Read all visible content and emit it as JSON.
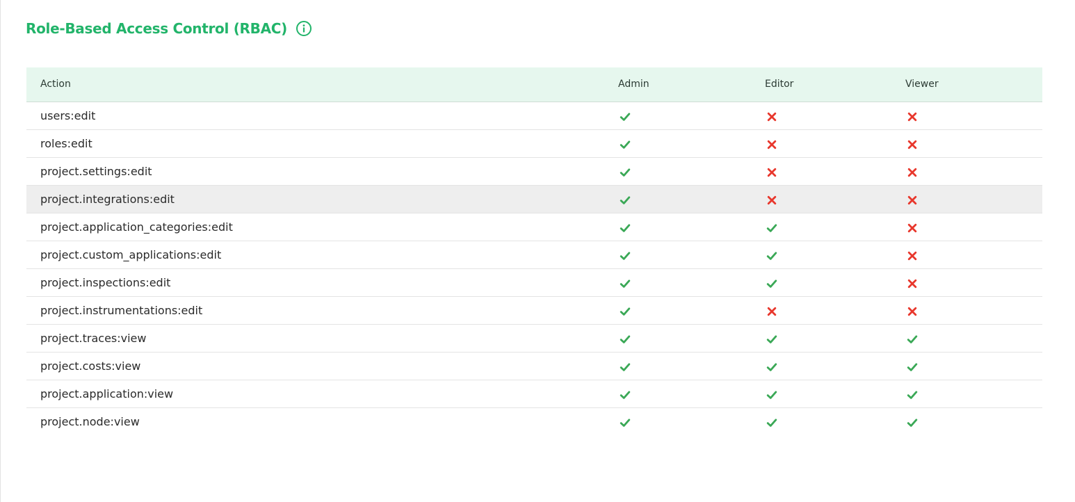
{
  "title": "Role-Based Access Control (RBAC)",
  "icons": {
    "info": "info-circle-icon",
    "allowed": "check-icon",
    "denied": "cross-icon"
  },
  "colors": {
    "accent": "#22b46a",
    "header_bg": "#e6f7ee",
    "check": "#3aa856",
    "cross": "#e8372c",
    "row_hover": "#eeeeee"
  },
  "table": {
    "headers": [
      "Action",
      "Admin",
      "Editor",
      "Viewer"
    ],
    "hovered_row": 3,
    "rows": [
      {
        "action": "users:edit",
        "admin": true,
        "editor": false,
        "viewer": false
      },
      {
        "action": "roles:edit",
        "admin": true,
        "editor": false,
        "viewer": false
      },
      {
        "action": "project.settings:edit",
        "admin": true,
        "editor": false,
        "viewer": false
      },
      {
        "action": "project.integrations:edit",
        "admin": true,
        "editor": false,
        "viewer": false
      },
      {
        "action": "project.application_categories:edit",
        "admin": true,
        "editor": true,
        "viewer": false
      },
      {
        "action": "project.custom_applications:edit",
        "admin": true,
        "editor": true,
        "viewer": false
      },
      {
        "action": "project.inspections:edit",
        "admin": true,
        "editor": true,
        "viewer": false
      },
      {
        "action": "project.instrumentations:edit",
        "admin": true,
        "editor": false,
        "viewer": false
      },
      {
        "action": "project.traces:view",
        "admin": true,
        "editor": true,
        "viewer": true
      },
      {
        "action": "project.costs:view",
        "admin": true,
        "editor": true,
        "viewer": true
      },
      {
        "action": "project.application:view",
        "admin": true,
        "editor": true,
        "viewer": true
      },
      {
        "action": "project.node:view",
        "admin": true,
        "editor": true,
        "viewer": true
      }
    ]
  }
}
